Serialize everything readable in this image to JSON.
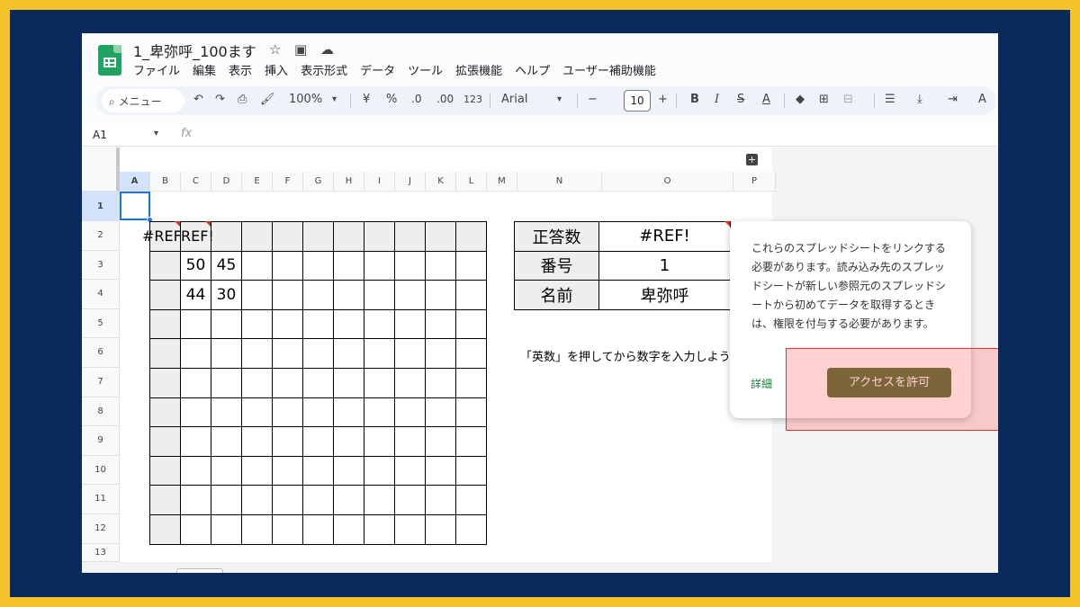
{
  "doc": {
    "title": "1_卑弥呼_100ます"
  },
  "menu": [
    "ファイル",
    "編集",
    "表示",
    "挿入",
    "表示形式",
    "データ",
    "ツール",
    "拡張機能",
    "ヘルプ",
    "ユーザー補助機能"
  ],
  "toolbar": {
    "search": "メニュー",
    "zoom": "100%",
    "currency": "¥",
    "percent": "%",
    "dec_decrease": ".0",
    "dec_increase": ".00",
    "number_format": "123",
    "font": "Arial",
    "font_size": "10"
  },
  "formula_bar": {
    "name_box": "A1",
    "fx": "fx"
  },
  "sheet": {
    "columns": [
      "A",
      "B",
      "C",
      "D",
      "E",
      "F",
      "G",
      "H",
      "I",
      "J",
      "K",
      "L",
      "M",
      "N",
      "O",
      "P"
    ],
    "rows": [
      "1",
      "2",
      "3",
      "4",
      "5",
      "6",
      "7",
      "8",
      "9",
      "10",
      "11",
      "12",
      "13"
    ],
    "ref_b2": "#REF",
    "ref_c2": "REF!",
    "grid": {
      "c3": "50",
      "d3": "45",
      "c4": "44",
      "d4": "30"
    },
    "info": {
      "score_label": "正答数",
      "score_value": "#REF!",
      "number_label": "番号",
      "number_value": "1",
      "name_label": "名前",
      "name_value": "卑弥呼"
    },
    "note": "「英数」を押してから数字を入力しよう"
  },
  "popup": {
    "message": "これらのスプレッドシートをリンクする必要があります。読み込み先のスプレッドシートが新しい参照元のスプレッドシートから初めてデータを取得するときは、権限を付与する必要があります。",
    "detail_link": "詳細",
    "grant_button": "アクセスを許可"
  },
  "colors": {
    "accent_green": "#4a6b2d",
    "selection": "#1a73e8",
    "highlight": "#e03030"
  }
}
